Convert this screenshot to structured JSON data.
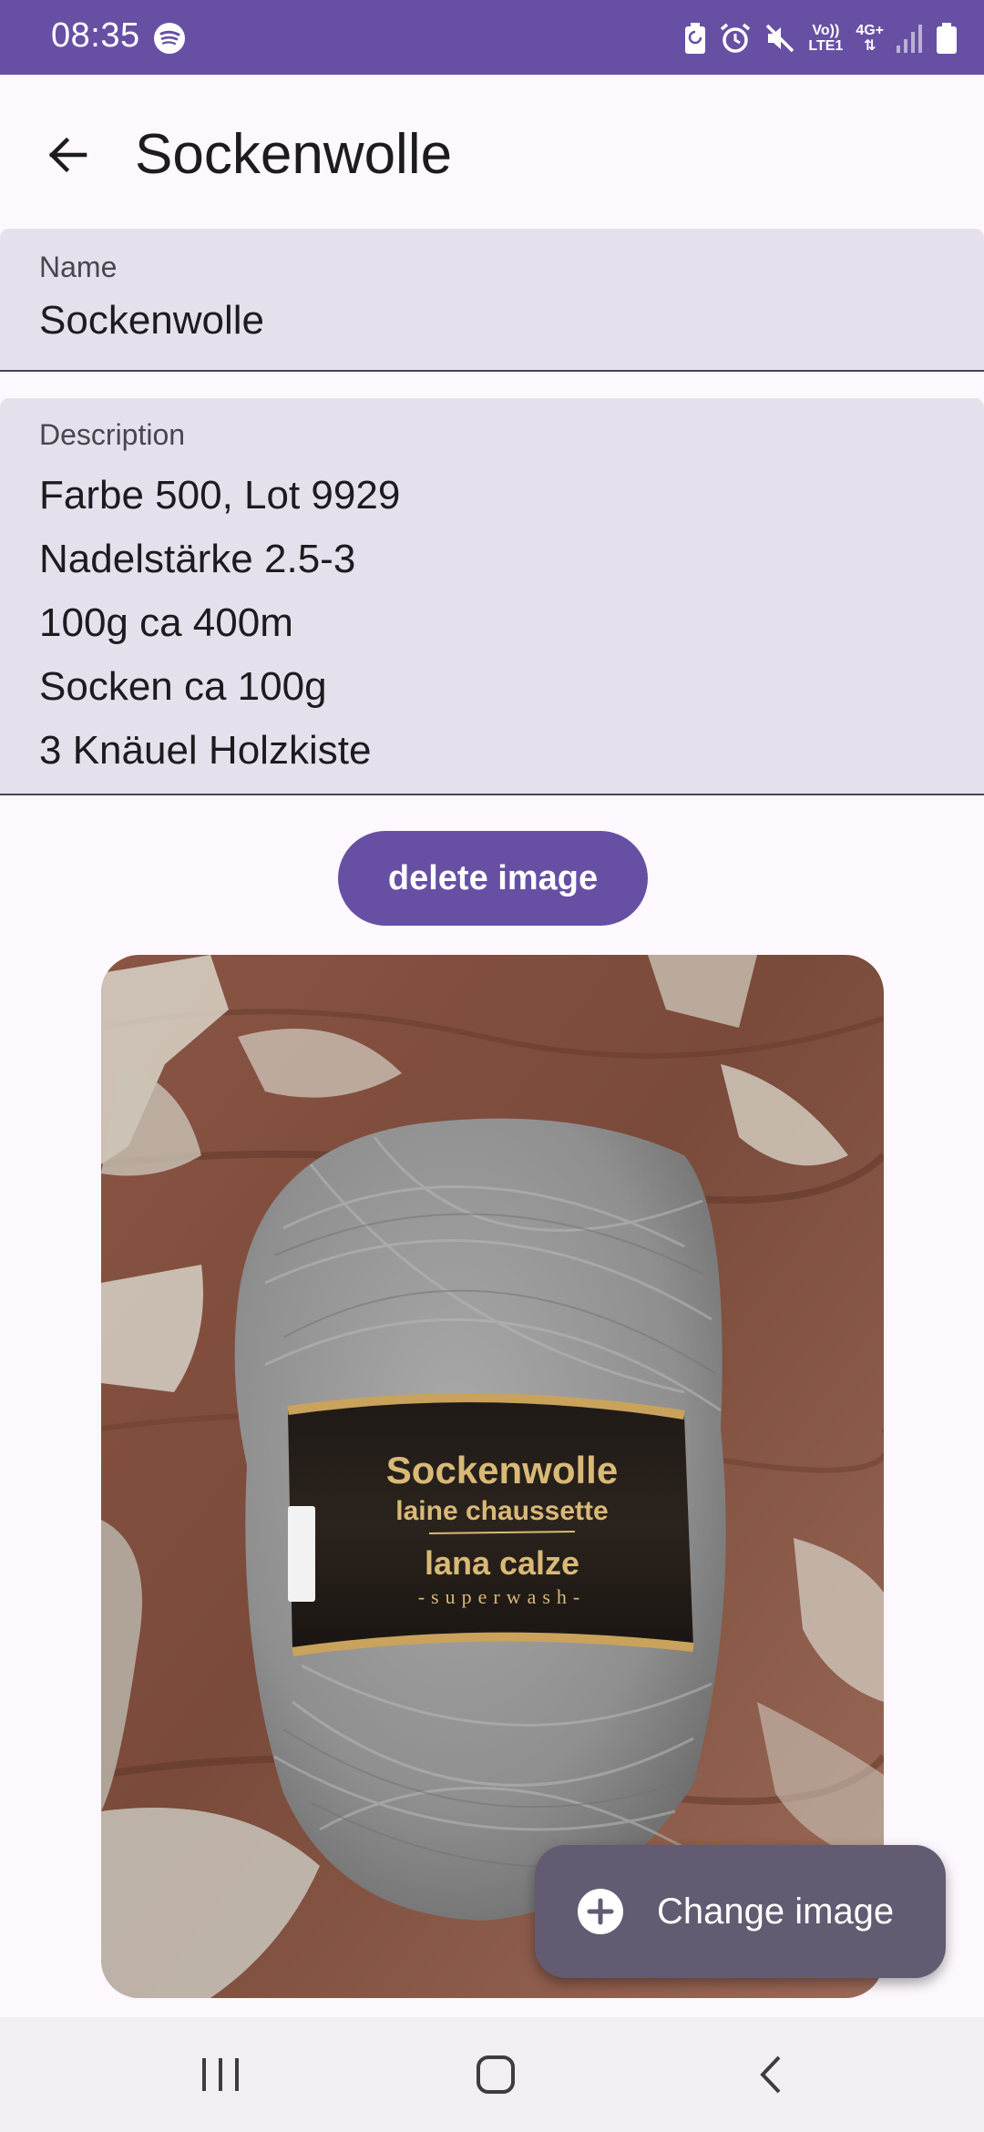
{
  "status_bar": {
    "time": "08:35",
    "network_line1": "Vo))",
    "network_line2": "LTE1",
    "network_type": "4G+",
    "icons": [
      "spotify-icon",
      "battery-saver-icon",
      "alarm-icon",
      "mute-icon",
      "signal-icon",
      "battery-icon"
    ]
  },
  "app_bar": {
    "title": "Sockenwolle",
    "back_icon": "arrow-back-icon"
  },
  "form": {
    "name": {
      "label": "Name",
      "value": "Sockenwolle"
    },
    "description": {
      "label": "Description",
      "lines": [
        "Farbe 500, Lot 9929",
        "Nadelstärke 2.5-3",
        "100g ca 400m",
        "Socken ca 100g",
        "3 Knäuel Holzkiste"
      ]
    }
  },
  "delete_button": {
    "label": "delete image"
  },
  "photo": {
    "band_line1": "Sockenwolle",
    "band_line2": "laine chaussette",
    "band_line3": "lana calze",
    "band_line4": "-superwash-"
  },
  "fab": {
    "label": "Change image",
    "icon": "add-circle-icon"
  },
  "nav_bar": {
    "icons": [
      "recents-icon",
      "home-icon",
      "back-icon"
    ]
  },
  "colors": {
    "primary": "#6750a4",
    "field_background": "#e6e0ec",
    "fab_background": "#625b71",
    "page_background": "#fdf8fd"
  }
}
